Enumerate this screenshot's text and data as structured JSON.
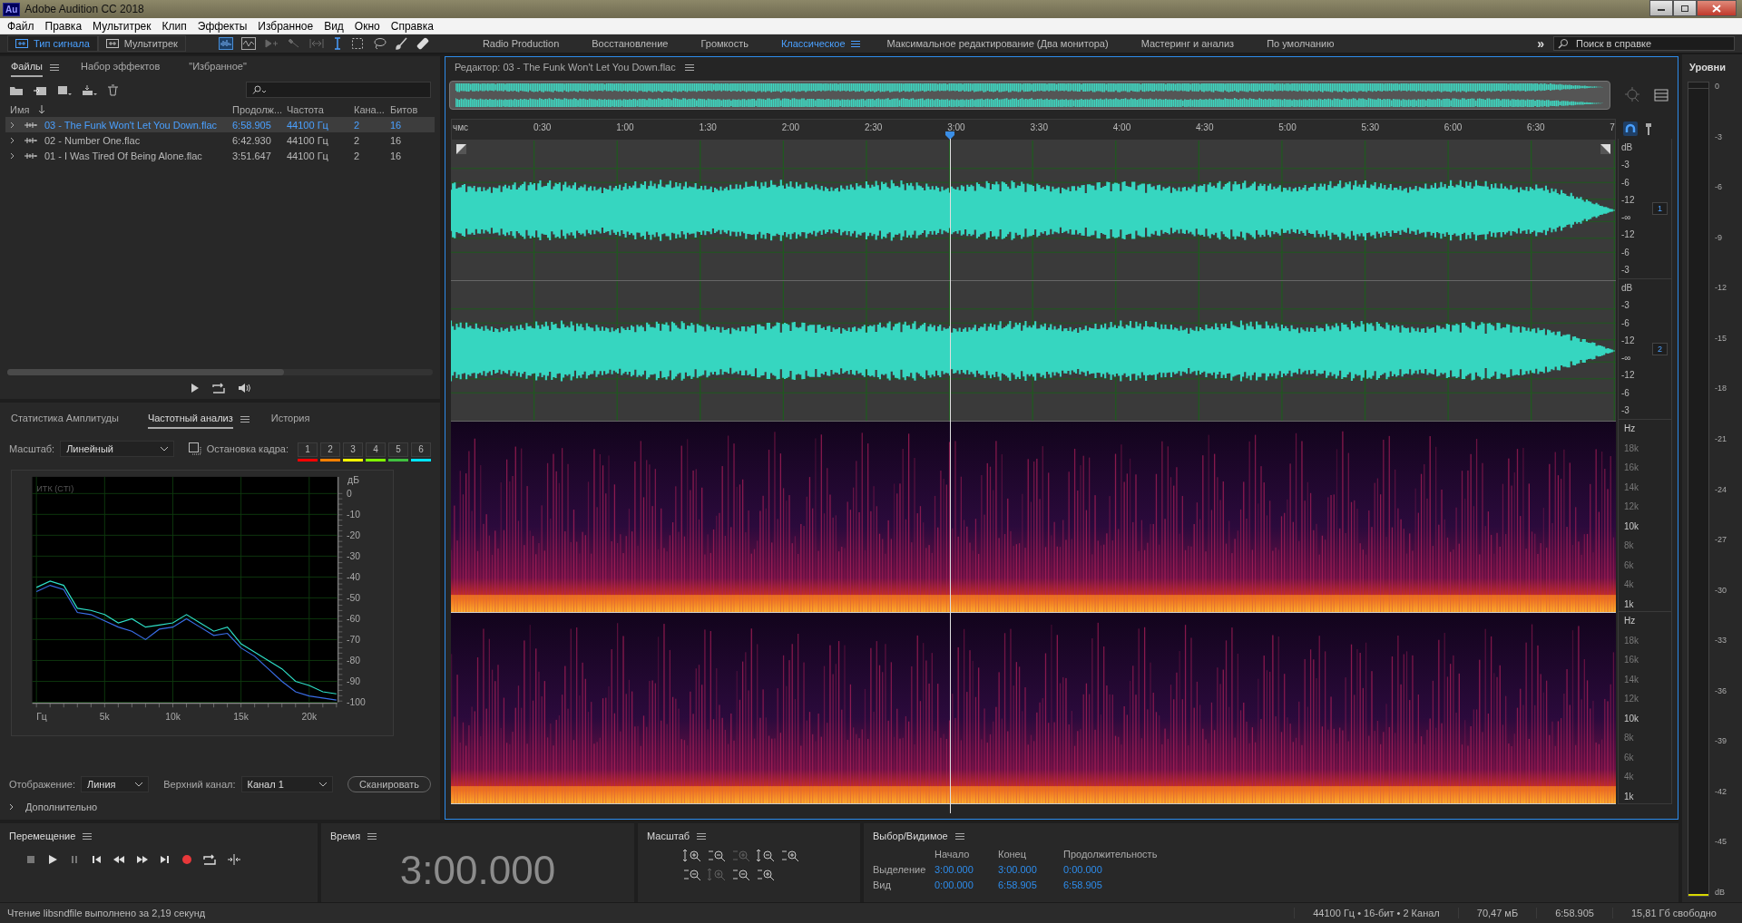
{
  "window": {
    "title": "Adobe Audition CC 2018",
    "logo": "Au"
  },
  "menu": [
    "Файл",
    "Правка",
    "Мультитрек",
    "Клип",
    "Эффекты",
    "Избранное",
    "Вид",
    "Окно",
    "Справка"
  ],
  "toolbar": {
    "modes": [
      {
        "label": "Тип сигнала",
        "selected": true
      },
      {
        "label": "Мультитрек",
        "selected": false
      }
    ],
    "workspaces": [
      {
        "label": "Radio Production",
        "selected": false
      },
      {
        "label": "Восстановление",
        "selected": false
      },
      {
        "label": "Громкость",
        "selected": false
      },
      {
        "label": "Классическое",
        "selected": true
      },
      {
        "label": "Максимальное редактирование (Два монитора)",
        "selected": false
      },
      {
        "label": "Мастеринг и анализ",
        "selected": false
      },
      {
        "label": "По умолчанию",
        "selected": false
      }
    ],
    "more": "»",
    "search": {
      "placeholder": "Поиск в справке"
    }
  },
  "files_panel": {
    "tabs": [
      {
        "label": "Файлы",
        "selected": true
      },
      {
        "label": "Набор эффектов",
        "selected": false
      },
      {
        "label": "\"Избранное\"",
        "selected": false
      }
    ],
    "columns": [
      "Имя",
      "Продолж...",
      "Частота",
      "Кана...",
      "Битов"
    ],
    "rows": [
      {
        "name": "03 - The Funk Won't Let You Down.flac",
        "duration": "6:58.905",
        "rate": "44100 Гц",
        "channels": "2",
        "bits": "16",
        "selected": true
      },
      {
        "name": "02 - Number One.flac",
        "duration": "6:42.930",
        "rate": "44100 Гц",
        "channels": "2",
        "bits": "16",
        "selected": false
      },
      {
        "name": "01 - I Was Tired Of Being Alone.flac",
        "duration": "3:51.647",
        "rate": "44100 Гц",
        "channels": "2",
        "bits": "16",
        "selected": false
      }
    ]
  },
  "analysis_panel": {
    "tabs": [
      {
        "label": "Статистика Амплитуды",
        "selected": false
      },
      {
        "label": "Частотный анализ",
        "selected": true
      },
      {
        "label": "История",
        "selected": false
      }
    ],
    "scale_label": "Масштаб:",
    "scale_value": "Линейный",
    "freeze_label": "Остановка кадра:",
    "freeze_slots": [
      {
        "label": "1",
        "color": "#ff0000"
      },
      {
        "label": "2",
        "color": "#ff8000"
      },
      {
        "label": "3",
        "color": "#ffff00"
      },
      {
        "label": "4",
        "color": "#80ff00"
      },
      {
        "label": "5",
        "color": "#40c040"
      },
      {
        "label": "6",
        "color": "#00e5ff"
      }
    ],
    "overlay_label": "ИТК (CTI)",
    "unit_label": "дБ",
    "chart_data": {
      "type": "line",
      "x": [
        0,
        1000,
        2000,
        3000,
        4000,
        5000,
        6000,
        7000,
        8000,
        9000,
        10000,
        11000,
        12000,
        13000,
        14000,
        15000,
        16000,
        17000,
        18000,
        19000,
        20000,
        21000,
        22000
      ],
      "series": [
        {
          "color": "#2ee0c8",
          "values": [
            -45,
            -42,
            -44,
            -55,
            -56,
            -58,
            -62,
            -60,
            -64,
            -63,
            -62,
            -58,
            -62,
            -66,
            -64,
            -72,
            -76,
            -80,
            -84,
            -90,
            -92,
            -95,
            -96
          ]
        },
        {
          "color": "#3a6ee8",
          "values": [
            -47,
            -44,
            -46,
            -57,
            -58,
            -61,
            -64,
            -66,
            -70,
            -65,
            -64,
            -60,
            -64,
            -68,
            -67,
            -74,
            -78,
            -84,
            -90,
            -95,
            -97,
            -98,
            -99
          ]
        }
      ],
      "xlim": [
        0,
        22050
      ],
      "ylim": [
        -100,
        0
      ],
      "xticks": [
        {
          "value": 0,
          "label": "Гц"
        },
        {
          "value": 5000,
          "label": "5k"
        },
        {
          "value": 10000,
          "label": "10k"
        },
        {
          "value": 15000,
          "label": "15k"
        },
        {
          "value": 20000,
          "label": "20k"
        }
      ],
      "yticks": [
        0,
        -10,
        -20,
        -30,
        -40,
        -50,
        -60,
        -70,
        -80,
        -90,
        -100
      ],
      "grid": true
    },
    "display_label": "Отображение:",
    "display_value": "Линия",
    "channel_label": "Верхний канал:",
    "channel_value": "Канал 1",
    "scan_button": "Сканировать",
    "advanced": "Дополнительно",
    "advanced_expanded": false
  },
  "editor": {
    "title": "Редактор: 03 - The Funk Won't Let You Down.flac",
    "ruler": [
      "чмс",
      "0:30",
      "1:00",
      "1:30",
      "2:00",
      "2:30",
      "3:00",
      "3:30",
      "4:00",
      "4:30",
      "5:00",
      "5:30",
      "6:00",
      "6:30",
      "7"
    ],
    "channels": [
      {
        "badge": "1",
        "db_labels": [
          "dB",
          "-3",
          "-6",
          "-12",
          "-∞",
          "-12",
          "-6",
          "-3"
        ]
      },
      {
        "badge": "2",
        "db_labels": [
          "dB",
          "-3",
          "-6",
          "-12",
          "-∞",
          "-12",
          "-6",
          "-3"
        ]
      }
    ],
    "spectra": [
      {
        "hz_labels": [
          "Hz",
          "18k",
          "16k",
          "14k",
          "12k",
          "10k",
          "8k",
          "6k",
          "4k",
          "1k"
        ]
      },
      {
        "hz_labels": [
          "Hz",
          "18k",
          "16k",
          "14k",
          "12k",
          "10k",
          "8k",
          "6k",
          "4k",
          "1k"
        ]
      }
    ]
  },
  "levels": {
    "title": "Уровни",
    "ticks": [
      "0",
      "-3",
      "-6",
      "-9",
      "-12",
      "-15",
      "-18",
      "-21",
      "-24",
      "-27",
      "-30",
      "-33",
      "-36",
      "-39",
      "-42",
      "-45"
    ],
    "unit": "dB"
  },
  "transport": {
    "title": "Перемещение"
  },
  "time": {
    "title": "Время",
    "value": "3:00.000"
  },
  "zoom": {
    "title": "Масштаб"
  },
  "selection": {
    "title": "Выбор/Видимое",
    "columns": [
      "Начало",
      "Конец",
      "Продолжительность"
    ],
    "rows": [
      {
        "label": "Выделение",
        "values": [
          "3:00.000",
          "3:00.000",
          "0:00.000"
        ]
      },
      {
        "label": "Вид",
        "values": [
          "0:00.000",
          "6:58.905",
          "6:58.905"
        ]
      }
    ]
  },
  "status_bar": {
    "message": "Чтение libsndfile выполнено за 2,19 секунд",
    "format": "44100 Гц • 16-бит • 2 Канал",
    "size": "70,47 мБ",
    "duration": "6:58.905",
    "free": "15,81 Гб свободно"
  }
}
